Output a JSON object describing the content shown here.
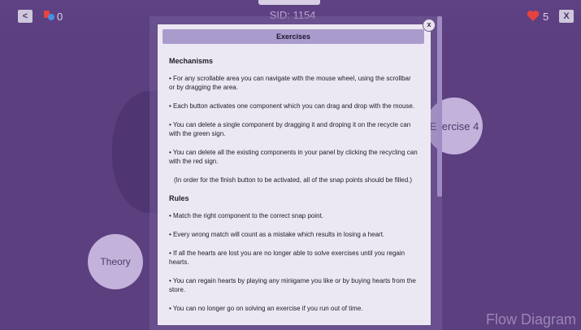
{
  "topbar": {
    "back_label": "<",
    "hint_count": "0",
    "sid": "SID: 1154",
    "hearts_count": "5",
    "close_label": "X"
  },
  "background": {
    "theory_label": "Theory",
    "exercise4_label": "Exercise 4",
    "flow_diagram_label": "Flow Diagram"
  },
  "modal": {
    "title": "Exercises",
    "close_label": "x",
    "mechanisms_title": "Mechanisms",
    "mechanisms": [
      "• For any scrollable area you can navigate with the mouse wheel, using the scrollbar or by dragging the area.",
      "• Each button activates one component which you can drag and drop with the mouse.",
      "• You can delete a single component by dragging it and droping it on the recycle can with the green sign.",
      "• You can delete all the existing components in your panel by clicking the recycling can with the red sign."
    ],
    "note": "(In order for the finish button to be activated, all of the snap points should be filled.)",
    "rules_title": "Rules",
    "rules": [
      "• Match the right component to the correct snap point.",
      "• Every wrong match will count as a mistake which results in losing a heart.",
      "• If all the hearts are lost you are no longer able to solve exercises until you regain hearts.",
      "• You can regain hearts by playing any minigame you like or by buying hearts from the store.",
      "• You can no longer go on solving an exercise if you run out of time."
    ]
  },
  "colors": {
    "background": "#5b3f7f",
    "modal_bg": "#ece8f3",
    "header_bg": "#a99ccd",
    "heart": "#e4433f"
  }
}
